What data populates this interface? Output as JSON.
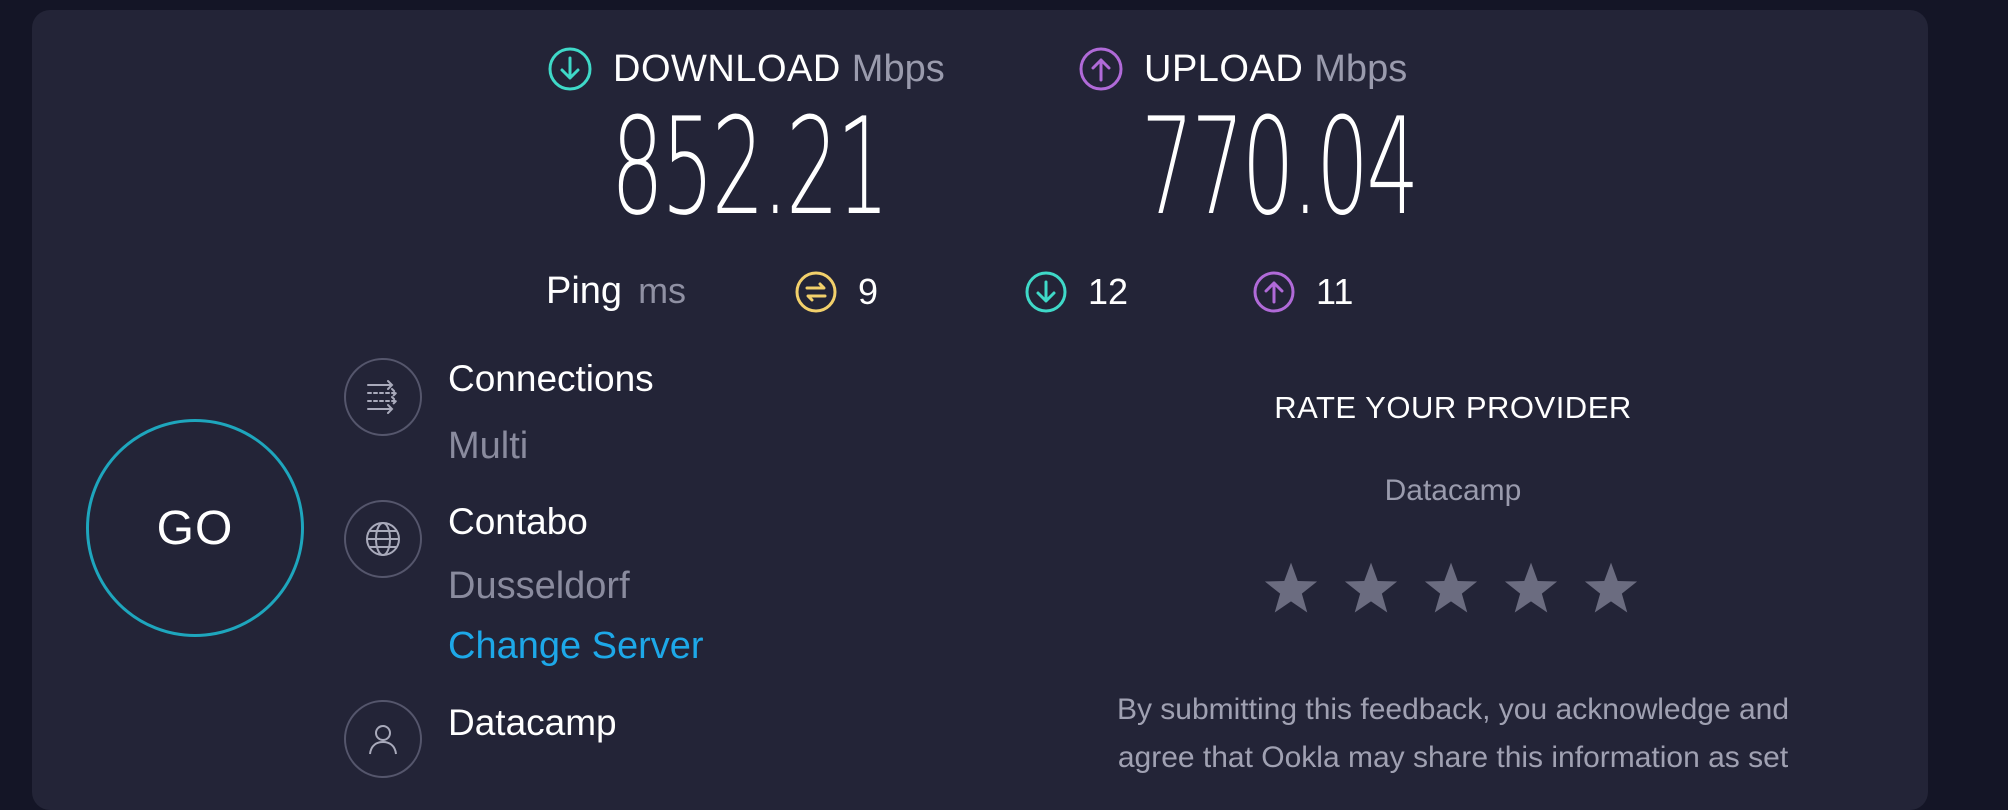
{
  "download": {
    "label": "DOWNLOAD",
    "unit": "Mbps",
    "value": "852.21",
    "icon": "arrow-down-circle-icon",
    "color": "#3fd9c8"
  },
  "upload": {
    "label": "UPLOAD",
    "unit": "Mbps",
    "value": "770.04",
    "icon": "arrow-up-circle-icon",
    "color": "#b06ad8"
  },
  "ping": {
    "label": "Ping",
    "unit": "ms",
    "idle": "9",
    "download": "12",
    "upload": "11",
    "idle_color": "#f2d06b"
  },
  "go_label": "GO",
  "connections": {
    "title": "Connections",
    "value": "Multi"
  },
  "server": {
    "name": "Contabo",
    "location": "Dusseldorf",
    "change_label": "Change Server"
  },
  "provider": {
    "name": "Datacamp"
  },
  "rating": {
    "title": "RATE YOUR PROVIDER",
    "provider": "Datacamp",
    "stars": 0,
    "max_stars": 5,
    "disclaimer_line1": "By submitting this feedback, you acknowledge and",
    "disclaimer_line2": "agree that Ookla may share this information as set"
  },
  "colors": {
    "background": "#141526",
    "panel": "#232437",
    "accent": "#1ea6bd",
    "link": "#1da8e8"
  }
}
